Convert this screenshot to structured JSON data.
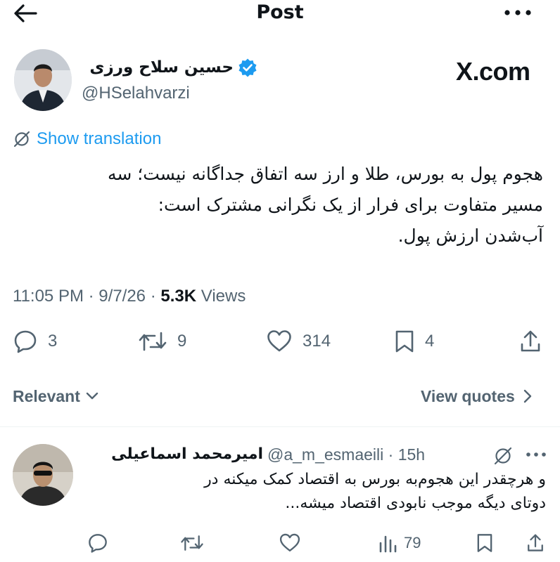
{
  "header": {
    "title": "Post",
    "back_icon": "arrow-left-icon",
    "more_icon": "more-dots-icon"
  },
  "author": {
    "name": "حسین سلاح ورزی",
    "handle": "@HSelahvarzi",
    "verified": true
  },
  "watermark": "X.com",
  "translation": {
    "label": "Show translation"
  },
  "tweet": {
    "lines": [
      "هجوم پول به بورس، طلا و ارز سه اتفاق جداگانه نیست؛ سه",
      "مسیر متفاوت برای فرار از یک نگرانی مشترک است:",
      "آب‌شدن ارزش پول."
    ],
    "time": "11:05 PM",
    "date": "9/7/26",
    "views_count": "5.3K",
    "views_label": "Views",
    "separator": "·"
  },
  "actions": {
    "replies": "3",
    "reposts": "9",
    "likes": "314",
    "bookmarks": "4"
  },
  "sort": {
    "label": "Relevant",
    "view_quotes": "View quotes"
  },
  "reply": {
    "name": "امیرمحمد اسماعیلی",
    "handle": "@a_m_esmaeili",
    "separator": "·",
    "time": "15h",
    "lines": [
      "و هرچقدر این هجوم‌به بورس به اقتصاد کمک میکنه در",
      "دوتای دیگه موجب نابودی اقتصاد میشه..."
    ],
    "views": "79"
  },
  "colors": {
    "accent": "#1d9bf0",
    "text": "#0f1419",
    "secondary": "#536471",
    "divider": "#eff3f4"
  }
}
